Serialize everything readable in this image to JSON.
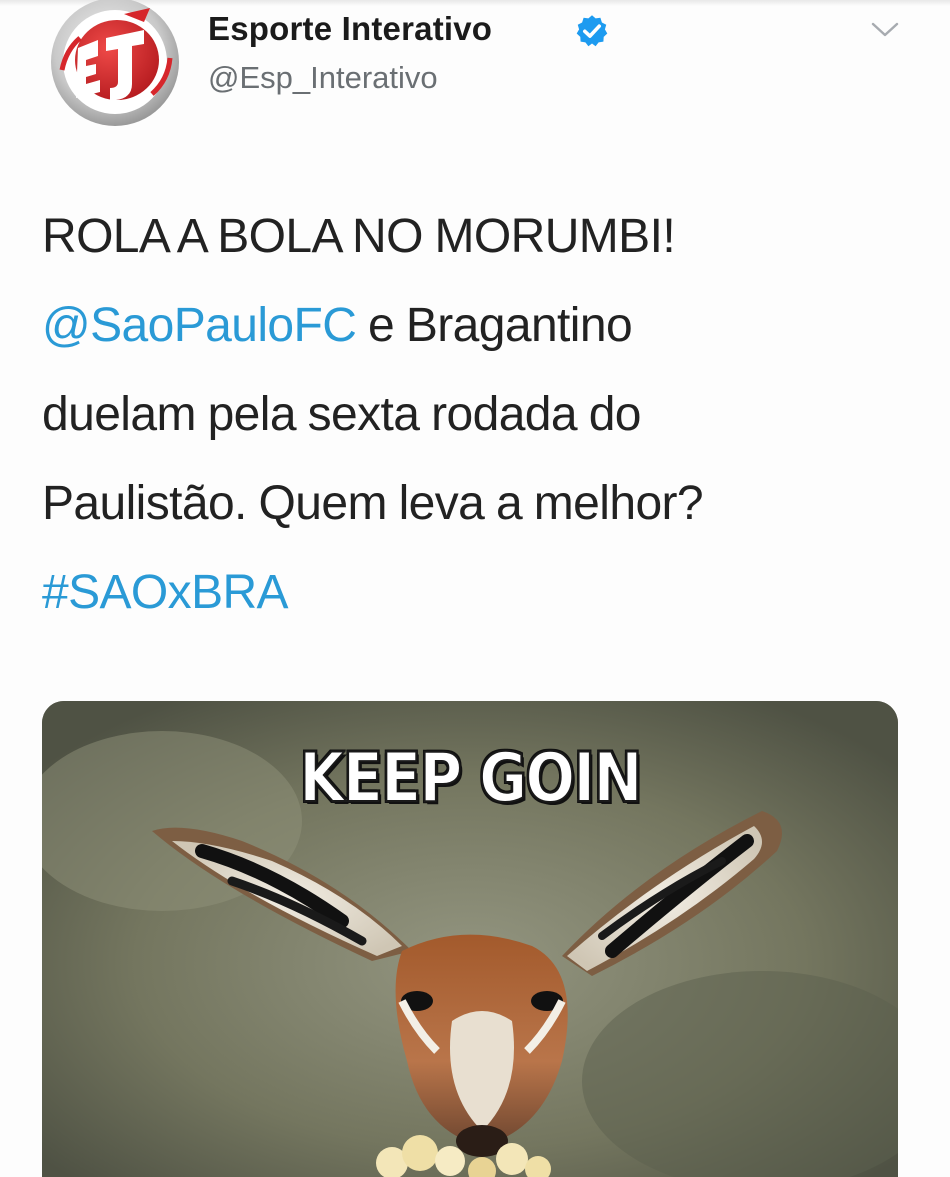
{
  "author": {
    "name": "Esporte Interativo",
    "handle": "@Esp_Interativo",
    "verified": true,
    "avatar_icon": "esporte-interativo-logo-icon"
  },
  "menu_icon": "chevron-down-icon",
  "tweet": {
    "line1": "ROLA A BOLA NO MORUMBI!",
    "mention": "@SaoPauloFC",
    "line2_rest": " e Bragantino",
    "line3": "duelam pela sexta rodada do",
    "line4": "Paulistão. Quem leva a melhor?",
    "hashtag": "#SAOxBRA"
  },
  "media": {
    "caption": "KEEP GOIN",
    "image_subject": "gazelle eating popcorn"
  },
  "colors": {
    "link": "#2a9ad6",
    "verified": "#1d9bf0",
    "logo_red": "#d6262b",
    "handle_gray": "#6a6f73"
  }
}
